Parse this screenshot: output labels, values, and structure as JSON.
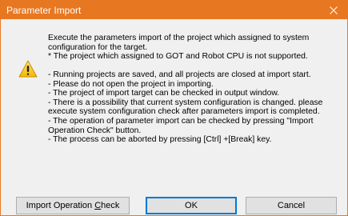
{
  "window": {
    "title": "Parameter Import",
    "accent_color": "#e87722"
  },
  "icons": {
    "warning": "warning-triangle-icon",
    "close": "close-icon"
  },
  "message": {
    "intro_lines": [
      "Execute the parameters import of the project which assigned to system",
      "configuration for the target.",
      "* The project which assigned to GOT and Robot CPU is not supported."
    ],
    "detail_lines": [
      "- Running projects are saved, and all projects are closed at import start.",
      "- Please do not open the project in importing.",
      "- The project of import target can be checked in output window.",
      "- There is a possibility that current system configuration is changed. please",
      "execute system configuration check after parameters import is completed.",
      "- The operation of parameter import can be checked by pressing \"Import",
      "Operation Check\" button.",
      "- The process can be aborted by pressing [Ctrl] +[Break] key."
    ]
  },
  "buttons": {
    "import_check_prefix": "Import Operation ",
    "import_check_mnemonic": "C",
    "import_check_suffix": "heck",
    "ok_label": "OK",
    "cancel_label": "Cancel"
  }
}
